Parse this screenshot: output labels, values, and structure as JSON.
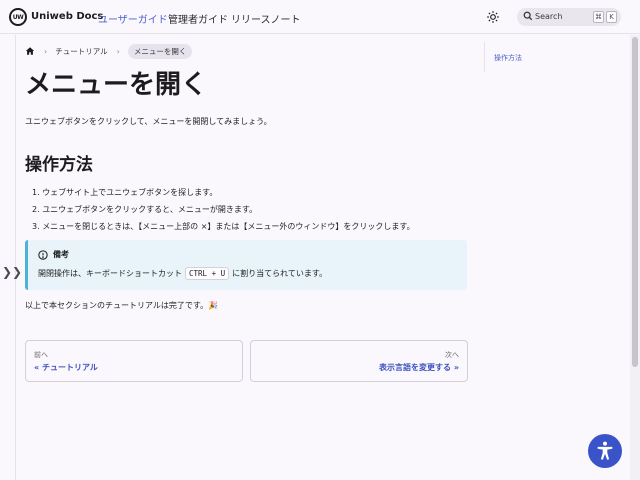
{
  "navbar": {
    "logo_text": "UW",
    "brand": "Uniweb Docs",
    "links": [
      {
        "label": "ユーザーガイド",
        "active": true
      },
      {
        "label": "管理者ガイド",
        "active": false
      },
      {
        "label": "リリースノート",
        "active": false
      }
    ],
    "search": {
      "label": "Search",
      "kbd1": "⌘",
      "kbd2": "K"
    }
  },
  "breadcrumb": {
    "items": [
      "チュートリアル",
      "メニューを開く"
    ]
  },
  "article": {
    "title": "メニューを開く",
    "intro": "ユニウェブボタンをクリックして、メニューを開閉してみましょう。",
    "section_title": "操作方法",
    "steps": [
      "ウェブサイト上でユニウェブボタンを探します。",
      "ユニウェブボタンをクリックすると、メニューが開きます。",
      "メニューを閉じるときは、【メニュー上部の ×】または【メニュー外のウィンドウ】をクリックします。"
    ],
    "note": {
      "title": "備考",
      "text_before": "開閉操作は、キーボードショートカット",
      "code": "CTRL + U",
      "text_after": "に割り当てられています。"
    },
    "outro": "以上で本セクションのチュートリアルは完了です。🎉"
  },
  "pagination": {
    "prev": {
      "sub": "前へ",
      "label": "« チュートリアル"
    },
    "next": {
      "sub": "次へ",
      "label": "表示言語を変更する »"
    }
  },
  "toc": {
    "items": [
      "操作方法"
    ]
  },
  "colors": {
    "accent": "#4a5fc9",
    "note_border": "#4cb3d4",
    "fab": "#3b53c9"
  },
  "icons": [
    "sun-icon",
    "search-icon",
    "home-icon",
    "info-icon",
    "collapse-icon",
    "accessibility-icon"
  ]
}
